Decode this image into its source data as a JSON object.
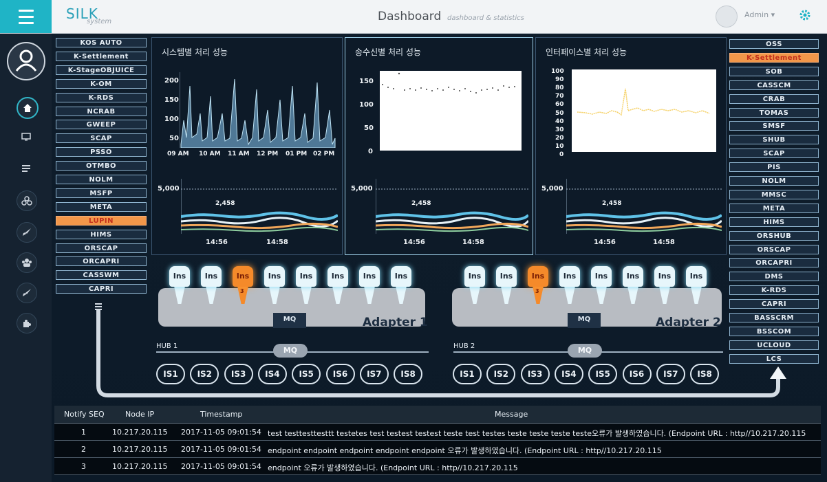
{
  "header": {
    "menu_icon": "hamburger-icon",
    "logo_main": "SILK",
    "logo_sub": "system",
    "title": "Dashboard",
    "subtitle": "dashboard & statistics",
    "user_label": "Admin",
    "user_chevron": "▾",
    "settings_icon": "gear-icon"
  },
  "colors": {
    "accent": "#1fb4c6",
    "highlight": "#f2974a",
    "panel": "#0d1a28"
  },
  "left_systems": [
    "KOS AUTO",
    "K-Settlement",
    "K-StageOBJUICE",
    "K-OM",
    "K-RDS",
    "NCRAB",
    "GWEEP",
    "SCAP",
    "PSSO",
    "OTMBO",
    "NOLM",
    "MSFP",
    "META",
    "LUPIN",
    "HIMS",
    "ORSCAP",
    "ORCAPRI",
    "CASSWM",
    "CAPRI"
  ],
  "left_highlight": "LUPIN",
  "right_systems": [
    "OSS",
    "K-Settlement",
    "SOB",
    "CASSCM",
    "CRAB",
    "TOMAS",
    "SMSF",
    "SHUB",
    "SCAP",
    "PIS",
    "NOLM",
    "MMSC",
    "META",
    "HIMS",
    "ORSHUB",
    "ORSCAP",
    "ORCAPRI",
    "DMS",
    "K-RDS",
    "CAPRI",
    "BASSCRM",
    "BSSCOM",
    "UCLOUD",
    "LCS"
  ],
  "right_highlight": "K-Settlement",
  "charts": {
    "system": {
      "title": "시스템별 처리 성능",
      "y_ticks": [
        "200",
        "150",
        "100",
        "50"
      ],
      "x_ticks": [
        "09 AM",
        "10 AM",
        "11 AM",
        "12 PM",
        "01 PM",
        "02 PM"
      ],
      "lower_y": "5,000",
      "lower_label": "2,458",
      "lower_x": [
        "14:56",
        "14:58"
      ]
    },
    "sendrecv": {
      "title": "송수신별 처리 성능",
      "y_ticks": [
        "150",
        "100",
        "50",
        "0"
      ],
      "lower_y": "5,000",
      "lower_label": "2,458",
      "lower_x": [
        "14:56",
        "14:58"
      ]
    },
    "interface": {
      "title": "인터페이스별 처리 성능",
      "y_ticks": [
        "100",
        "90",
        "80",
        "70",
        "60",
        "50",
        "40",
        "30",
        "20",
        "10",
        "0"
      ],
      "lower_y": "5,000",
      "lower_label": "2,458",
      "lower_x": [
        "14:56",
        "14:58"
      ]
    }
  },
  "adapter1": {
    "label": "Adapter 1",
    "mq": "MQ",
    "instances": [
      "Ins",
      "Ins",
      "Ins",
      "Ins",
      "Ins",
      "Ins",
      "Ins",
      "Ins"
    ],
    "hot_index": 2,
    "hot_num": "3"
  },
  "adapter2": {
    "label": "Adapter 2",
    "mq": "MQ",
    "instances": [
      "Ins",
      "Ins",
      "Ins",
      "Ins",
      "Ins",
      "Ins",
      "Ins",
      "Ins"
    ],
    "hot_index": 2,
    "hot_num": "3"
  },
  "hub1": {
    "label": "HUB 1",
    "mq": "MQ",
    "nodes": [
      "IS1",
      "IS2",
      "IS3",
      "IS4",
      "IS5",
      "IS6",
      "IS7",
      "IS8"
    ]
  },
  "hub2": {
    "label": "HUB 2",
    "mq": "MQ",
    "nodes": [
      "IS1",
      "IS2",
      "IS3",
      "IS4",
      "IS5",
      "IS6",
      "IS7",
      "IS8"
    ]
  },
  "table": {
    "headers": [
      "Notify SEQ",
      "Node IP",
      "Timestamp",
      "Message"
    ],
    "rows": [
      [
        "1",
        "10.217.20.115",
        "2017-11-05 09:01:54",
        "test testtesttesttt  testetes test   testest  testest  teste  test  testes  teste teste teste teste오류가 발생하였습니다. (Endpoint URL : http//10.217.20.115"
      ],
      [
        "2",
        "10.217.20.115",
        "2017-11-05 09:01:54",
        "endpoint endpoint endpoint   endpoint endpoint 오류가 발생하였습니다. (Endpoint URL : http//10.217.20.115"
      ],
      [
        "3",
        "10.217.20.115",
        "2017-11-05 09:01:54",
        "endpoint 오류가 발생하였습니다. (Endpoint URL : http//10.217.20.115"
      ]
    ]
  }
}
